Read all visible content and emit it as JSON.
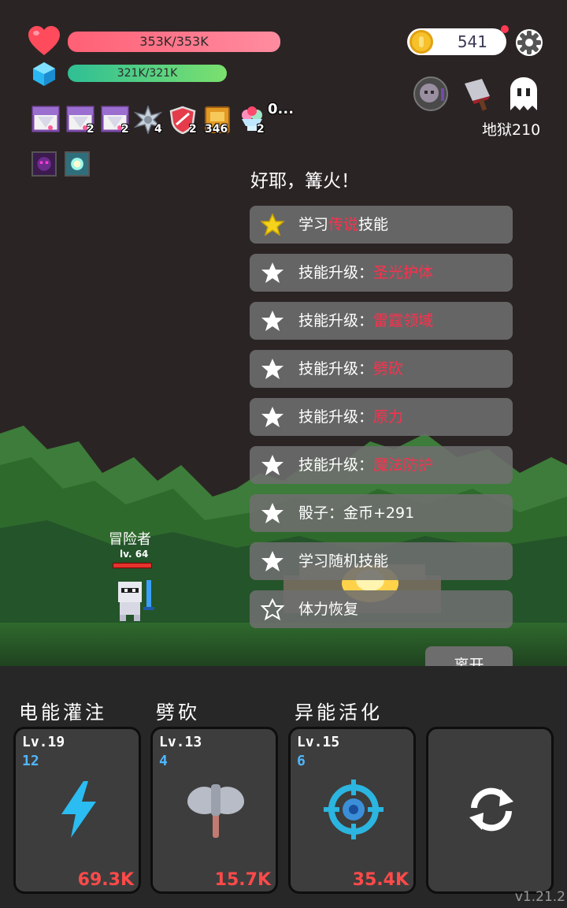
{
  "hud": {
    "hp_text": "353K/353K",
    "mp_text": "321K/321K",
    "coins": "541",
    "floor_label": "地狱210"
  },
  "buffs": [
    {
      "icon": "scroll-icon",
      "count": ""
    },
    {
      "icon": "scroll-icon",
      "count": "2"
    },
    {
      "icon": "scroll-icon",
      "count": "2"
    },
    {
      "icon": "spiked-ball-icon",
      "count": "4"
    },
    {
      "icon": "shield-icon",
      "count": "2"
    },
    {
      "icon": "book-icon",
      "count": "346"
    },
    {
      "icon": "ice-cream-icon",
      "count": "2"
    },
    {
      "icon": "more-icon",
      "count": "0..."
    }
  ],
  "event": {
    "title": "好耶，篝火！",
    "options": [
      {
        "prefix": "学习",
        "highlight": "传说",
        "suffix": "技能",
        "star": "gold"
      },
      {
        "prefix": "技能升级：",
        "highlight": "圣光护体",
        "suffix": "",
        "star": "white"
      },
      {
        "prefix": "技能升级：",
        "highlight": "雷霆领域",
        "suffix": "",
        "star": "white"
      },
      {
        "prefix": "技能升级：",
        "highlight": "劈砍",
        "suffix": "",
        "star": "white"
      },
      {
        "prefix": "技能升级：",
        "highlight": "原力",
        "suffix": "",
        "star": "white"
      },
      {
        "prefix": "技能升级：",
        "highlight": "魔法防护",
        "suffix": "",
        "star": "white"
      },
      {
        "prefix": "骰子：金币+291",
        "highlight": "",
        "suffix": "",
        "star": "white"
      },
      {
        "prefix": "学习随机技能",
        "highlight": "",
        "suffix": "",
        "star": "white"
      },
      {
        "prefix": "体力恢复",
        "highlight": "",
        "suffix": "",
        "star": "outline"
      }
    ],
    "leave_label": "离开"
  },
  "hero": {
    "name": "冒险者",
    "level": "lv. 64"
  },
  "skills": [
    {
      "name": "电能灌注",
      "level": "Lv.19",
      "cooldown": "12",
      "damage": "69.3K",
      "icon": "lightning-icon"
    },
    {
      "name": "劈砍",
      "level": "Lv.13",
      "cooldown": "4",
      "damage": "15.7K",
      "icon": "axe-icon"
    },
    {
      "name": "异能活化",
      "level": "Lv.15",
      "cooldown": "6",
      "damage": "35.4K",
      "icon": "target-icon"
    },
    {
      "name": "",
      "level": "",
      "cooldown": "",
      "damage": "",
      "icon": "refresh-icon"
    }
  ],
  "version": "v1.21.2",
  "colors": {
    "hp": "#ff6f85",
    "mp": "#3fcf8c",
    "highlight": "#ff2f4d",
    "damage": "#ff4a4a",
    "cooldown": "#4fb7ff"
  }
}
